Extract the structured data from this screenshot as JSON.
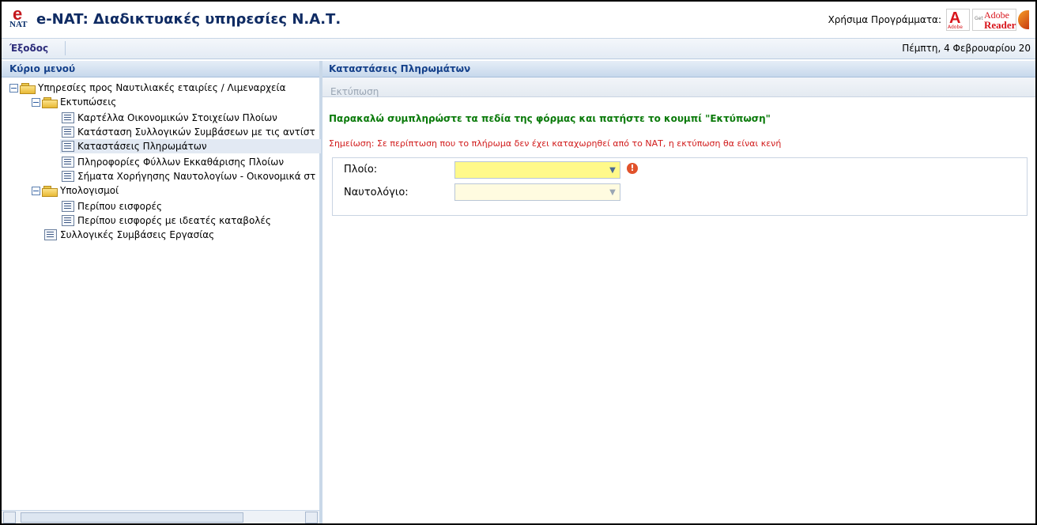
{
  "header": {
    "logo_top": "e",
    "logo_bottom": "NAT",
    "title": "e-NAT: Διαδικτυακές υπηρεσίες Ν.Α.Τ.",
    "useful_label": "Χρήσιμα Προγράμματα:",
    "acrobat_letter": "A",
    "acrobat_small": "Adobe",
    "reader_get": "Get",
    "reader_adobe": "Adobe",
    "reader_reader": "Reader"
  },
  "toolbar": {
    "exit_label": "Έξοδος",
    "date": "Πέμπτη, 4 Φεβρουαρίου 20"
  },
  "left_panel": {
    "title": "Κύριο μενού",
    "tree": [
      {
        "label": "Υπηρεσίες προς Ναυτιλιακές εταιρίες / Λιμεναρχεία",
        "type": "folder"
      },
      {
        "label": "Εκτυπώσεις",
        "type": "folder"
      },
      {
        "label": "Καρτέλλα Οικονομικών Στοιχείων Πλοίων",
        "type": "doc"
      },
      {
        "label": "Κατάσταση Συλλογικών Συμβάσεων με τις αντίστ",
        "type": "doc"
      },
      {
        "label": "Καταστάσεις Πληρωμάτων",
        "type": "doc",
        "selected": true
      },
      {
        "label": "Πληροφορίες Φύλλων Εκκαθάρισης Πλοίων",
        "type": "doc"
      },
      {
        "label": "Σήματα Χορήγησης Ναυτολογίων - Οικονομικά στ",
        "type": "doc"
      },
      {
        "label": "Υπολογισμοί",
        "type": "folder"
      },
      {
        "label": "Περίπου εισφορές",
        "type": "doc"
      },
      {
        "label": "Περίπου εισφορές με ιδεατές καταβολές",
        "type": "doc"
      },
      {
        "label": "Συλλογικές Συμβάσεις Εργασίας",
        "type": "doc"
      }
    ]
  },
  "right_panel": {
    "title": "Καταστάσεις Πληρωμάτων",
    "print_label": "Εκτύπωση",
    "instruction": "Παρακαλώ συμπληρώστε τα πεδία της φόρμας και πατήστε το κουμπί \"Εκτύπωση\"",
    "note": "Σημείωση: Σε περίπτωση που το πλήρωμα δεν έχει καταχωρηθεί από το ΝΑΤ, η εκτύπωση θα είναι κενή",
    "fields": [
      {
        "label": "Πλοίο:",
        "value": "",
        "placeholder": ""
      },
      {
        "label": "Ναυτολόγιο:",
        "value": "",
        "placeholder": ""
      }
    ],
    "error_icon": "!"
  },
  "icons": {
    "dropdown": "chevron-down-icon",
    "error": "exclamation-icon",
    "folder": "folder-icon",
    "document": "document-icon",
    "collapse": "minus-box-icon"
  },
  "colors": {
    "title_blue": "#0f2b63",
    "panel_header_text": "#14408a",
    "instruction_green": "#0a7a0a",
    "note_red": "#d11a1a",
    "required_field_bg": "#fff98a",
    "disabled_field_bg": "#fffbe0"
  }
}
